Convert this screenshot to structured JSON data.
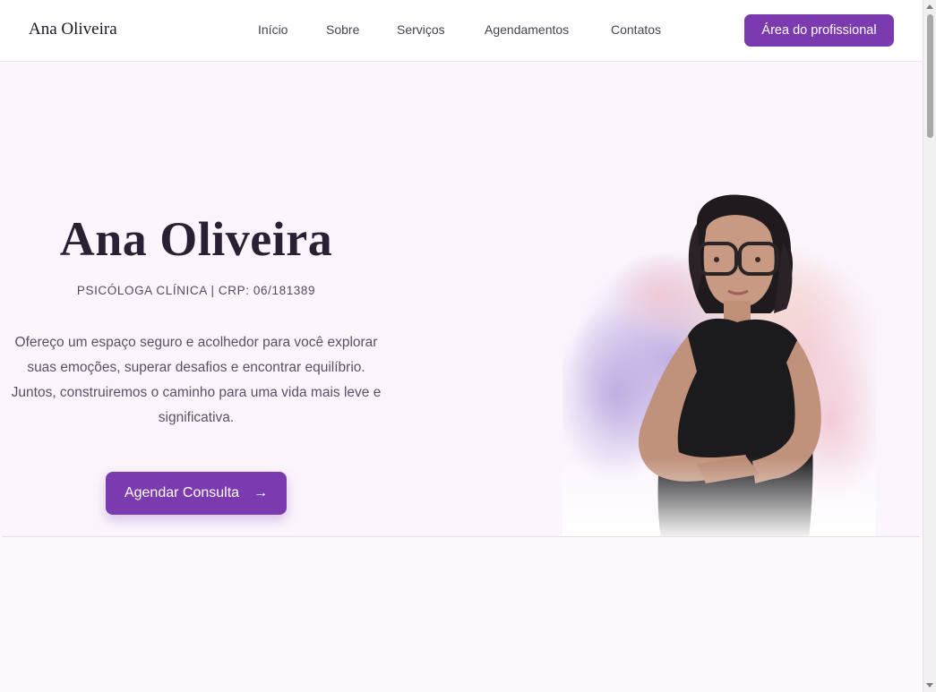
{
  "header": {
    "brand": "Ana Oliveira",
    "nav": [
      "Início",
      "Sobre",
      "Serviços",
      "Agendamentos",
      "Contatos"
    ],
    "pro_button": "Área do profissional"
  },
  "hero": {
    "name": "Ana Oliveira",
    "credentials": "PSICÓLOGA CLÍNICA | CRP: 06/181389",
    "intro": "Ofereço um espaço seguro e acolhedor para você explorar suas emoções, superar desafios e encontrar equilíbrio. Juntos, construiremos o caminho para uma vida mais leve e significativa.",
    "cta": "Agendar Consulta",
    "cta_icon": "arrow-right-icon"
  },
  "colors": {
    "accent": "#7b3aad",
    "background": "#fbf6fd"
  }
}
